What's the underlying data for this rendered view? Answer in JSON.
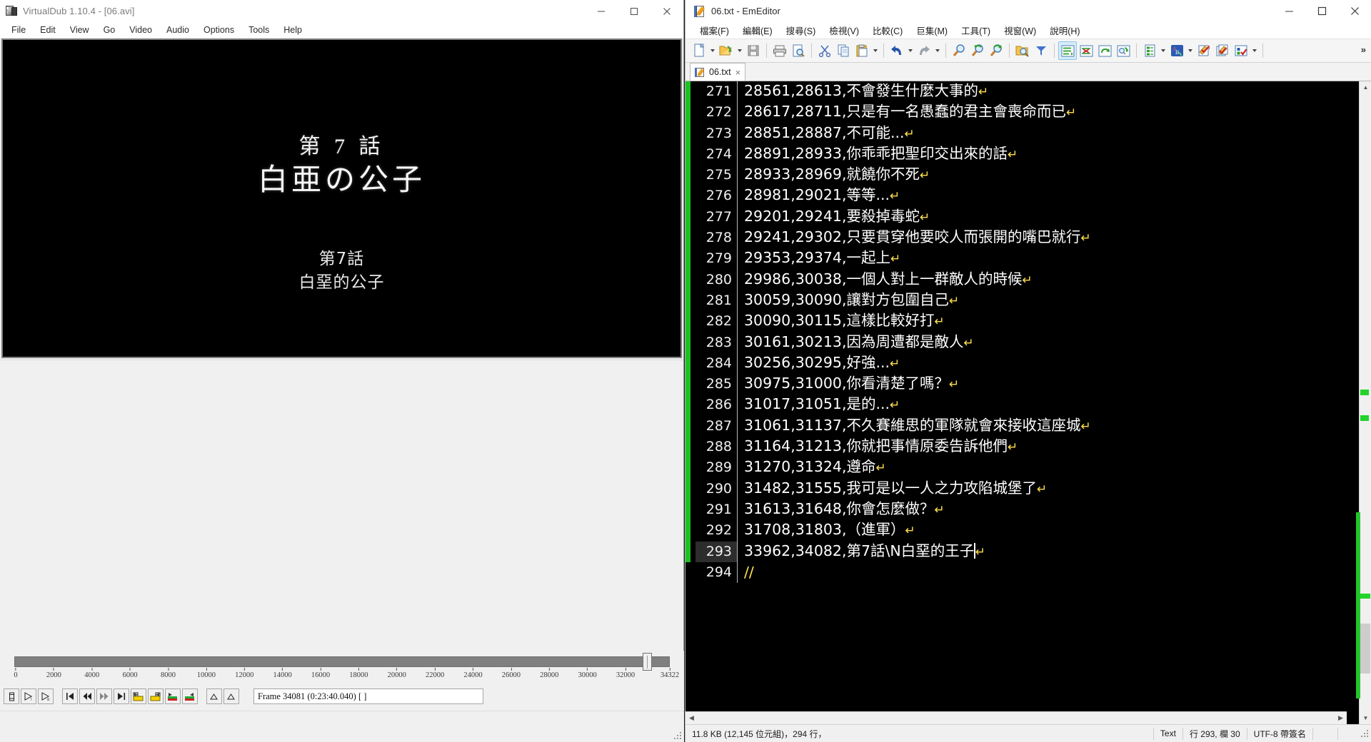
{
  "virtualdub": {
    "title": "VirtualDub 1.10.4 - [06.avi]",
    "icon": "filmstrip-icon",
    "menus": [
      "File",
      "Edit",
      "View",
      "Go",
      "Video",
      "Audio",
      "Options",
      "Tools",
      "Help"
    ],
    "window_controls": {
      "minimize": "minimize-icon",
      "maximize": "maximize-icon",
      "close": "close-icon"
    },
    "video": {
      "title_line1": "第 7 話",
      "title_line2": "白亜の公子",
      "subtitle_line1": "第7話",
      "subtitle_line2": "白堊的公子"
    },
    "timeline": {
      "ticks": [
        "0",
        "2000",
        "4000",
        "6000",
        "8000",
        "10000",
        "12000",
        "14000",
        "16000",
        "18000",
        "20000",
        "22000",
        "24000",
        "26000",
        "28000",
        "30000",
        "32000",
        "34322"
      ],
      "max_frame": 34322,
      "thumb_position_frame": 34081
    },
    "transport_buttons": [
      "stop-button",
      "play-button",
      "play-output-button",
      "start-button",
      "prev-keyframe-button",
      "next-keyframe-button",
      "end-button",
      "mark-in-button",
      "mark-out-button",
      "prev-edit-button",
      "next-edit-button",
      "scene-prev-button",
      "scene-next-button"
    ],
    "frame_status": "Frame 34081 (0:23:40.040) [ ]"
  },
  "emeditor": {
    "title": "06.txt - EmEditor",
    "icon": "emeditor-notepad-icon",
    "window_controls": {
      "minimize": "minimize-icon",
      "maximize": "maximize-icon",
      "close": "close-icon"
    },
    "menus": [
      "檔案(F)",
      "編輯(E)",
      "搜尋(S)",
      "檢視(V)",
      "比較(C)",
      "巨集(M)",
      "工具(T)",
      "視窗(W)",
      "說明(H)"
    ],
    "toolbar": [
      "new-file-icon",
      "open-file-icon",
      "save-file-icon",
      "print-icon",
      "print-preview-icon",
      "cut-icon",
      "copy-icon",
      "paste-icon",
      "undo-icon",
      "redo-icon",
      "find-icon",
      "find-previous-icon",
      "find-next-icon",
      "find-in-files-icon",
      "filter-icon",
      "wrap-lines-icon",
      "markdown-icon",
      "refresh-icon",
      "browser-preview-icon",
      "outline-icon",
      "spell-check-icon",
      "macro-run-icon",
      "macro-list-icon",
      "select-checks-icon"
    ],
    "toolbar_overflow": "»",
    "tab": {
      "label": "06.txt",
      "close": "×"
    },
    "lines": [
      {
        "num": "271",
        "text": "28561,28613,不會發生什麼大事的",
        "eol": true,
        "bookmark": true
      },
      {
        "num": "272",
        "text": "28617,28711,只是有一名愚蠢的君主會喪命而已",
        "eol": true,
        "bookmark": true
      },
      {
        "num": "273",
        "text": "28851,28887,不可能...",
        "eol": true,
        "bookmark": true
      },
      {
        "num": "274",
        "text": "28891,28933,你乖乖把聖印交出來的話",
        "eol": true,
        "bookmark": true
      },
      {
        "num": "275",
        "text": "28933,28969,就饒你不死",
        "eol": true,
        "bookmark": true
      },
      {
        "num": "276",
        "text": "28981,29021,等等...",
        "eol": true,
        "bookmark": true
      },
      {
        "num": "277",
        "text": "29201,29241,要殺掉毒蛇",
        "eol": true,
        "bookmark": true
      },
      {
        "num": "278",
        "text": "29241,29302,只要貫穿他要咬人而張開的嘴巴就行",
        "eol": true,
        "bookmark": true
      },
      {
        "num": "279",
        "text": "29353,29374,一起上",
        "eol": true,
        "bookmark": true
      },
      {
        "num": "280",
        "text": "29986,30038,一個人對上一群敵人的時候",
        "eol": true,
        "bookmark": true
      },
      {
        "num": "281",
        "text": "30059,30090,讓對方包圍自己",
        "eol": true,
        "bookmark": true
      },
      {
        "num": "282",
        "text": "30090,30115,這樣比較好打",
        "eol": true,
        "bookmark": true
      },
      {
        "num": "283",
        "text": "30161,30213,因為周遭都是敵人",
        "eol": true,
        "bookmark": true
      },
      {
        "num": "284",
        "text": "30256,30295,好強...",
        "eol": true,
        "bookmark": true
      },
      {
        "num": "285",
        "text": "30975,31000,你看清楚了嗎？",
        "eol": true,
        "bookmark": true
      },
      {
        "num": "286",
        "text": "31017,31051,是的...",
        "eol": true,
        "bookmark": true
      },
      {
        "num": "287",
        "text": "31061,31137,不久賽維思的軍隊就會來接收這座城",
        "eol": true,
        "bookmark": true
      },
      {
        "num": "288",
        "text": "31164,31213,你就把事情原委告訴他們",
        "eol": true,
        "bookmark": true
      },
      {
        "num": "289",
        "text": "31270,31324,遵命",
        "eol": true,
        "bookmark": true
      },
      {
        "num": "290",
        "text": "31482,31555,我可是以一人之力攻陷城堡了",
        "eol": true,
        "bookmark": true
      },
      {
        "num": "291",
        "text": "31613,31648,你會怎麼做？",
        "eol": true,
        "bookmark": true
      },
      {
        "num": "292",
        "text": "31708,31803,（進軍）",
        "eol": true,
        "bookmark": true
      },
      {
        "num": "293",
        "text": "33962,34082,第7話\\N白堊的王子",
        "eol": true,
        "bookmark": true,
        "current": true,
        "caret": true
      },
      {
        "num": "294",
        "text": "//",
        "eol": false,
        "bookmark": false,
        "comment": true
      }
    ],
    "statusbar": {
      "file_info": "11.8 KB (12,145 位元組)，294 行，",
      "mode": "Text",
      "position": "行 293, 欄 30",
      "encoding": "UTF-8 帶簽名"
    }
  },
  "colors": {
    "editor_bg": "#000000",
    "editor_fg": "#ffffff",
    "eol_marker": "#ffe14d",
    "bookmark_green": "#19c421",
    "minimap_green": "#22c52b",
    "selection_blue": "#d7ecfb"
  }
}
